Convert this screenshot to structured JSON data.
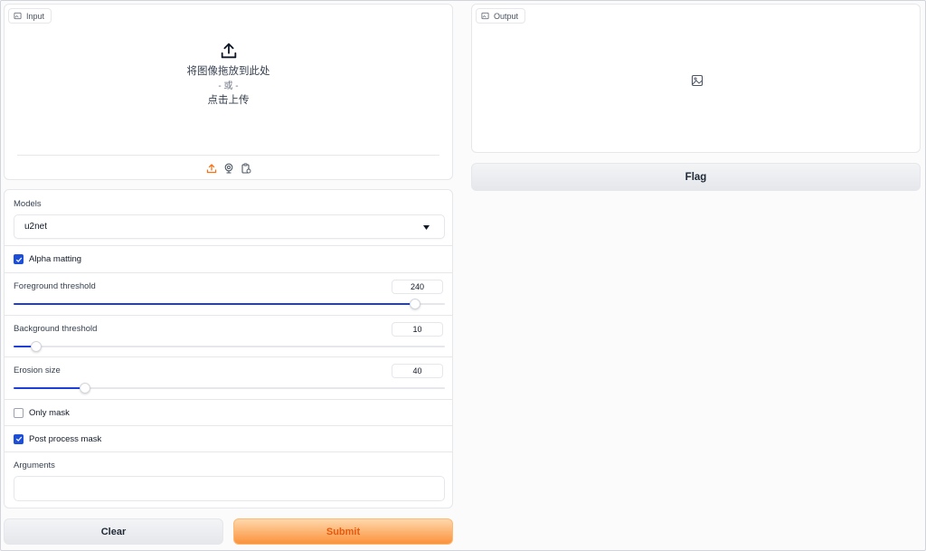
{
  "input": {
    "label": "Input",
    "drop_text": "将图像拖放到此处",
    "or_text": "- 或 -",
    "click_text": "点击上传",
    "sources": [
      {
        "name": "upload-icon"
      },
      {
        "name": "webcam-icon"
      },
      {
        "name": "clipboard-icon"
      }
    ]
  },
  "output": {
    "label": "Output",
    "placeholder_icon": "image-icon",
    "flag_label": "Flag"
  },
  "options": {
    "models": {
      "label": "Models",
      "selected": "u2net"
    },
    "alpha_matting": {
      "label": "Alpha matting",
      "checked": true
    },
    "foreground_threshold": {
      "label": "Foreground threshold",
      "value": "240",
      "fraction": 0.931
    },
    "background_threshold": {
      "label": "Background threshold",
      "value": "10",
      "fraction": 0.052
    },
    "erosion_size": {
      "label": "Erosion size",
      "value": "40",
      "fraction": 0.166
    },
    "only_mask": {
      "label": "Only mask",
      "checked": false
    },
    "post_process_mask": {
      "label": "Post process mask",
      "checked": true
    },
    "arguments": {
      "label": "Arguments",
      "value": ""
    }
  },
  "actions": {
    "clear_label": "Clear",
    "submit_label": "Submit"
  },
  "colors": {
    "accent": "#1d3fd8",
    "submit_text": "#ea580c",
    "upload_icon_active": "#f97316"
  }
}
